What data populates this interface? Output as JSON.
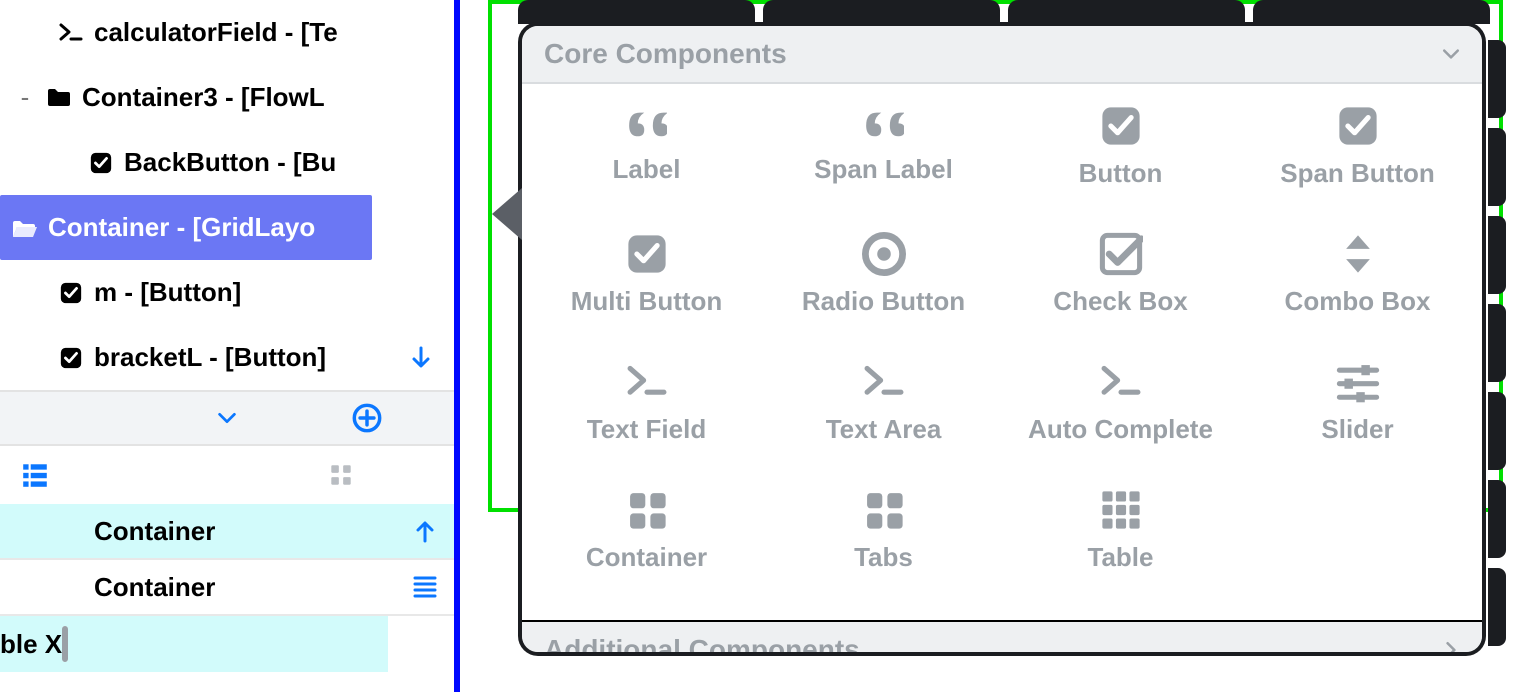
{
  "tree": {
    "items": [
      {
        "icon": "prompt",
        "label": "calculatorField - [Te",
        "indent": 2
      },
      {
        "icon": "folder",
        "label": "Container3 - [FlowL",
        "indent": 1,
        "collapsible": true
      },
      {
        "icon": "check",
        "label": "BackButton - [Bu",
        "indent": 3
      },
      {
        "icon": "folder-open",
        "label": "Container - [GridLayo",
        "indent": 1,
        "selected": true
      },
      {
        "icon": "check",
        "label": "m - [Button]",
        "indent": 3
      },
      {
        "icon": "check",
        "label": "bracketL - [Button]",
        "indent": 3,
        "trailing": "arrow-down"
      }
    ]
  },
  "bottom_list": {
    "rows": [
      {
        "label": "Container",
        "highlight": true,
        "action_icon": "arrow-up"
      },
      {
        "label": "Container",
        "highlight": false,
        "action_icon": "menu-lines"
      }
    ],
    "last": {
      "label": "ble X"
    }
  },
  "palette": {
    "core_header": "Core Components",
    "additional_header": "Additional Components",
    "items": [
      {
        "icon": "quote",
        "label": "Label"
      },
      {
        "icon": "quote",
        "label": "Span Label"
      },
      {
        "icon": "check-square",
        "label": "Button"
      },
      {
        "icon": "check-square",
        "label": "Span Button"
      },
      {
        "icon": "check-square",
        "label": "Multi Button"
      },
      {
        "icon": "radio",
        "label": "Radio Button"
      },
      {
        "icon": "checkbox",
        "label": "Check Box"
      },
      {
        "icon": "combo",
        "label": "Combo Box"
      },
      {
        "icon": "prompt",
        "label": "Text Field"
      },
      {
        "icon": "prompt",
        "label": "Text Area"
      },
      {
        "icon": "prompt",
        "label": "Auto Complete"
      },
      {
        "icon": "sliders",
        "label": "Slider"
      },
      {
        "icon": "grid4",
        "label": "Container"
      },
      {
        "icon": "grid4",
        "label": "Tabs"
      },
      {
        "icon": "grid9",
        "label": "Table"
      }
    ]
  }
}
